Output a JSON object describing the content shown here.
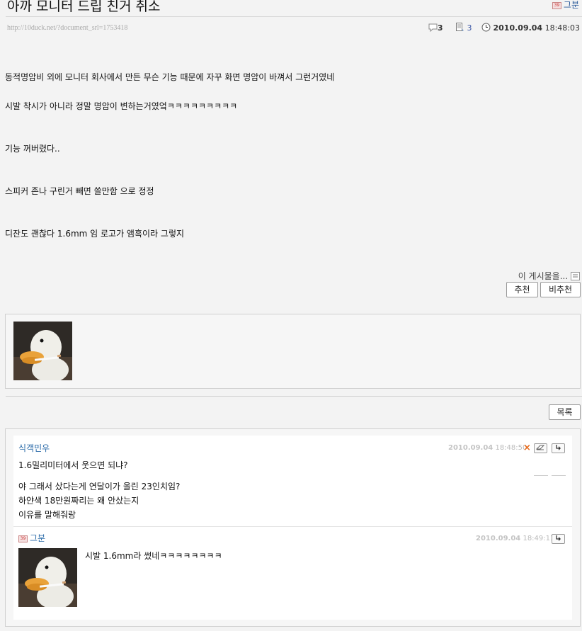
{
  "post": {
    "title": "아까 모니터 드립 친거 취소",
    "author": "그분",
    "url": "http://10duck.net/?document_srl=1753418",
    "comment_count": "3",
    "read_count": "3",
    "date": "2010.09.04",
    "time": "18:48:03",
    "paragraphs": [
      "동적명암비 외에 모니터 회사에서 만든 무슨 기능 때문에 자꾸 화면 명암이 바껴서 그런거였네",
      "시발 착시가 아니라 정말 명암이 변하는거였엌ㅋㅋㅋㅋㅋㅋㅋㅋㅋ",
      "기능 꺼버렸다..",
      "스피커 존나 구린거 빼면 쓸만함 으로 정정",
      "디잔도 괜찮다 1.6mm 임 로고가 앰흑이라 그렇지"
    ]
  },
  "actions": {
    "report_label": "이 게시물을...",
    "recommend": "추천",
    "not_recommend": "비추천",
    "list": "목록"
  },
  "comments": [
    {
      "nick": "식객민우",
      "date": "2010.09.04",
      "time": "18:48:50",
      "lines": [
        "1.6밀리미터에서 웃으면 되냐?",
        "야 그래서 샀다는게 연달이가 올린 23인치임?",
        "하얀색 18만원짜리는 왜 안샀는지",
        "이유를 말해줘랑"
      ]
    },
    {
      "nick": "그분",
      "date": "2010.09.04",
      "time": "18:49:11",
      "lines": [
        "시발 1.6mm라 썼네ㅋㅋㅋㅋㅋㅋㅋㅋ"
      ]
    }
  ],
  "icons": {
    "comment": "speech-bubble-icon",
    "read": "document-icon",
    "clock": "clock-icon",
    "delete": "close-icon",
    "modify": "eraser-icon",
    "reply": "reply-arrow-icon"
  },
  "colors": {
    "link_blue": "#2a6aa8",
    "delete_orange": "#e86a1a"
  }
}
